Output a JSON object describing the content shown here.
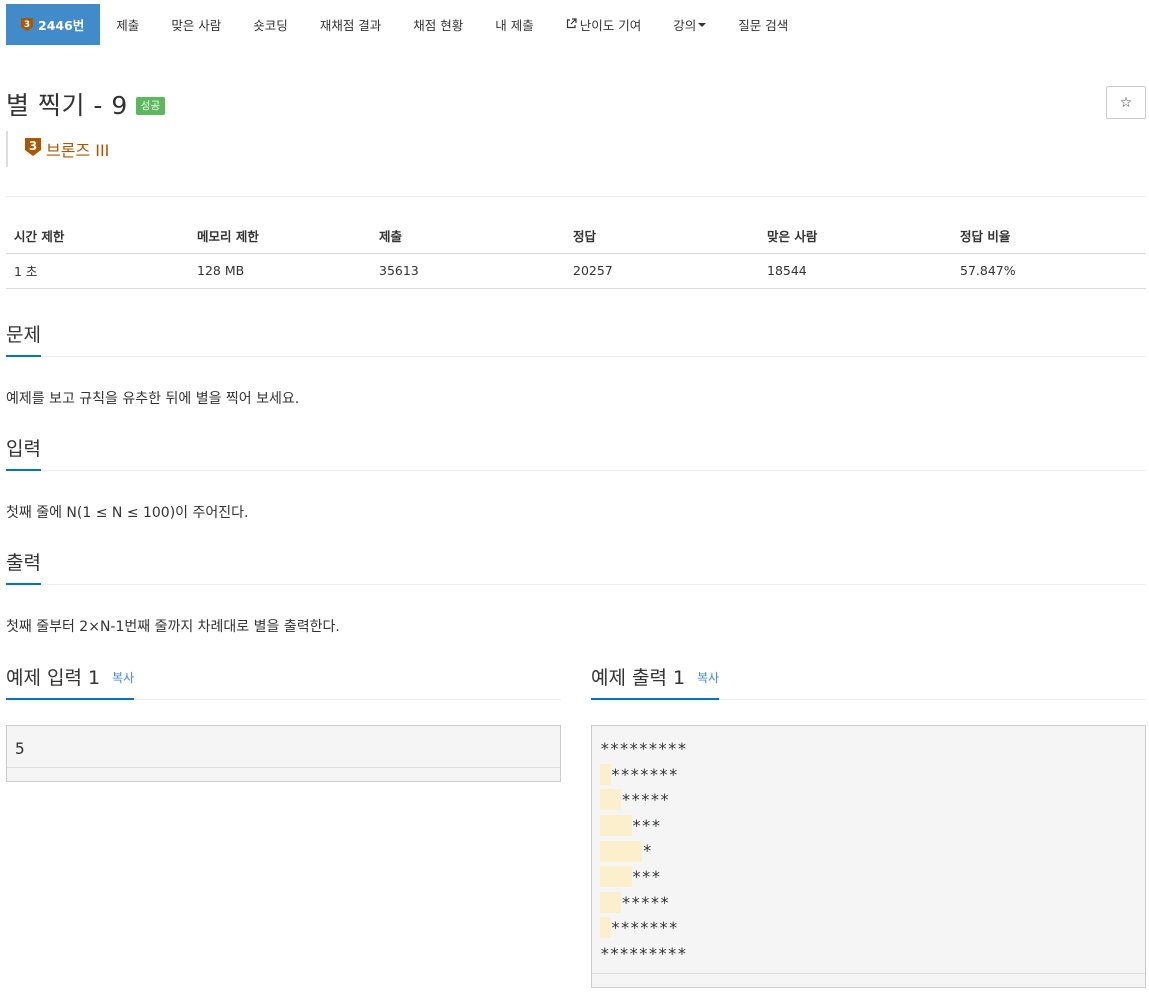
{
  "nav": {
    "items": [
      {
        "label": "2446번",
        "active": true
      },
      {
        "label": "제출"
      },
      {
        "label": "맞은 사람"
      },
      {
        "label": "숏코딩"
      },
      {
        "label": "재채점 결과"
      },
      {
        "label": "채점 현황"
      },
      {
        "label": "내 제출"
      },
      {
        "label": "난이도 기여"
      },
      {
        "label": "강의"
      },
      {
        "label": "질문 검색"
      }
    ]
  },
  "tier_number": "3",
  "problem": {
    "title": "별 찍기 - 9",
    "result": "성공",
    "tier": "브론즈 III",
    "star": "☆"
  },
  "info": {
    "headers": [
      "시간 제한",
      "메모리 제한",
      "제출",
      "정답",
      "맞은 사람",
      "정답 비율"
    ],
    "values": [
      "1 초",
      "128 MB",
      "35613",
      "20257",
      "18544",
      "57.847%"
    ]
  },
  "sections": {
    "description": {
      "title": "문제",
      "text": "예제를 보고 규칙을 유추한 뒤에 별을 찍어 보세요."
    },
    "input": {
      "title": "입력",
      "text": "첫째 줄에 N(1 ≤ N ≤ 100)이 주어진다."
    },
    "output": {
      "title": "출력",
      "text": "첫째 줄부터 2×N-1번째 줄까지 차례대로 별을 출력한다."
    }
  },
  "samples": {
    "input": {
      "title": "예제 입력 1",
      "copy": "복사",
      "lines": [
        "5"
      ]
    },
    "output": {
      "title": "예제 출력 1",
      "copy": "복사",
      "lines": [
        {
          "indent": 0,
          "stars": "*********"
        },
        {
          "indent": 1,
          "stars": "*******"
        },
        {
          "indent": 2,
          "stars": "*****"
        },
        {
          "indent": 3,
          "stars": "***"
        },
        {
          "indent": 4,
          "stars": "*"
        },
        {
          "indent": 3,
          "stars": "***"
        },
        {
          "indent": 2,
          "stars": "*****"
        },
        {
          "indent": 1,
          "stars": "*******"
        },
        {
          "indent": 0,
          "stars": "*********"
        }
      ]
    }
  }
}
